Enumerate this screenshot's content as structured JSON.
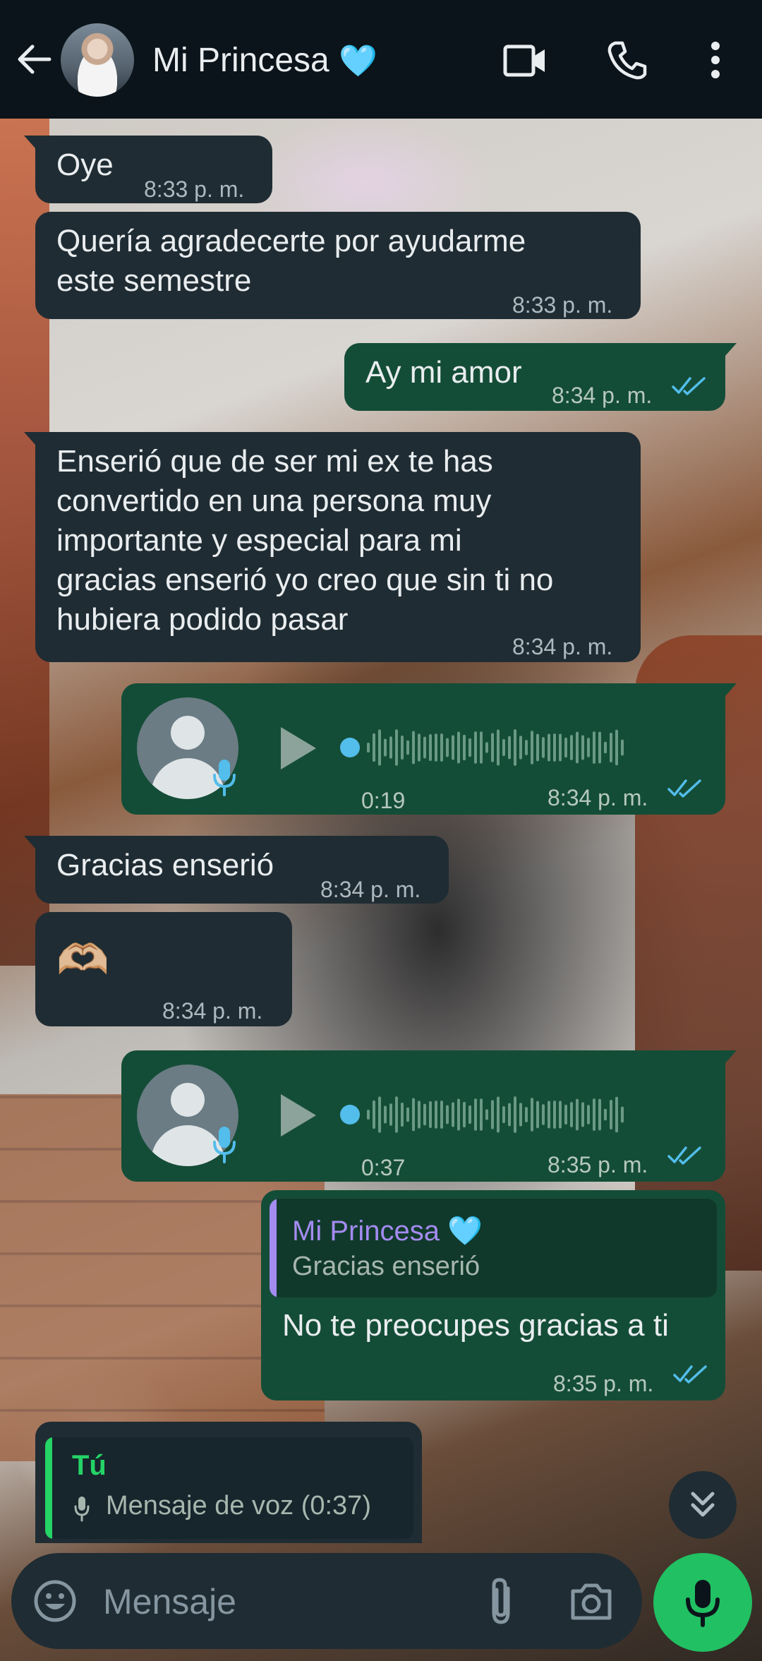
{
  "header": {
    "contact_name": "Mi Princesa",
    "heart": "🩵"
  },
  "messages": [
    {
      "direction": "in",
      "text": "Oye",
      "time": "8:33 p. m."
    },
    {
      "direction": "in",
      "text": "Quería agradecerte por ayudarme\neste semestre",
      "time": "8:33 p. m."
    },
    {
      "direction": "out",
      "text": "Ay mi amor",
      "time": "8:34 p. m.",
      "status": "read"
    },
    {
      "direction": "in",
      "text": "Enserió que de ser mi ex te has\nconvertido en una persona muy\nimportante y especial para mi\ngracias enserió yo creo que sin ti no\nhubiera podido pasar",
      "time": "8:34 p. m."
    },
    {
      "direction": "out",
      "type": "voice",
      "duration": "0:19",
      "time": "8:34 p. m.",
      "status": "read"
    },
    {
      "direction": "in",
      "text": "Gracias enserió",
      "time": "8:34 p. m."
    },
    {
      "direction": "in",
      "text": "🫶🏼",
      "time": "8:34 p. m."
    },
    {
      "direction": "out",
      "type": "voice",
      "duration": "0:37",
      "time": "8:35 p. m.",
      "status": "read"
    },
    {
      "direction": "out",
      "quote": {
        "name": "Mi Princesa",
        "heart": "🩵",
        "text": "Gracias enserió"
      },
      "text": "No te preocupes gracias a ti",
      "time": "8:35 p. m.",
      "status": "read"
    }
  ],
  "reply_preview": {
    "name": "Tú",
    "text": "Mensaje de voz (0:37)"
  },
  "composer": {
    "placeholder": "Mensaje"
  },
  "colors": {
    "header_bg": "#0b141a",
    "incoming_bubble": "#1f2c33",
    "outgoing_bubble": "#144d37",
    "read_ticks": "#53bdeb",
    "accent_green": "#21c063",
    "quote_name": "#a48bf0"
  }
}
